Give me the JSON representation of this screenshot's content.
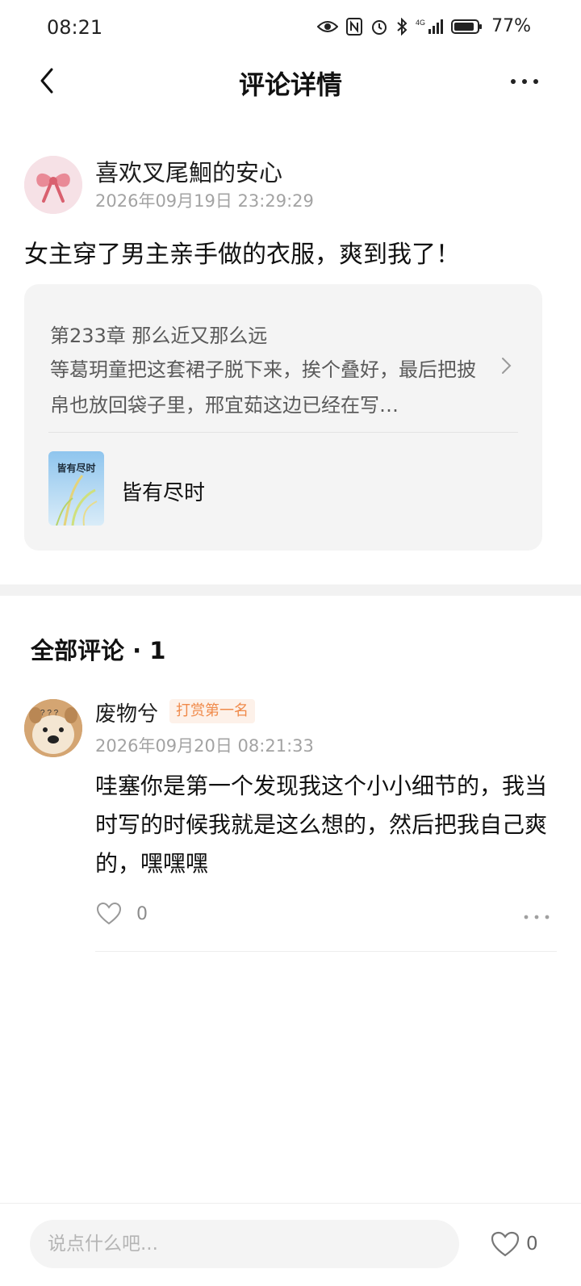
{
  "status_bar": {
    "time": "08:21",
    "battery": "77%",
    "signal_label": "4G"
  },
  "nav": {
    "title": "评论详情"
  },
  "post": {
    "author_name": "喜欢叉尾鮰的安心",
    "timestamp": "2026年09月19日 23:29:29",
    "text": "女主穿了男主亲手做的衣服，爽到我了！",
    "chapter_title": "第233章 那么近又那么远",
    "chapter_excerpt": "等葛玥童把这套裙子脱下来，挨个叠好，最后把披帛也放回袋子里，邢宜茹这边已经在写…",
    "book_title": "皆有尽时",
    "book_cover_text": "皆有尽时"
  },
  "comments_section": {
    "header": "全部评论 · 1",
    "comments": [
      {
        "author": "废物兮",
        "badge": "打赏第一名",
        "timestamp": "2026年09月20日 08:21:33",
        "text": "哇塞你是第一个发现我这个小小细节的，我当时写的时候我就是这么想的，然后把我自己爽的，嘿嘿嘿",
        "likes": "0"
      }
    ]
  },
  "bottom_bar": {
    "input_placeholder": "说点什么吧...",
    "likes": "0"
  },
  "colors": {
    "badge_text": "#f08a4a",
    "badge_bg": "#fdf1e9",
    "card_bg": "#f4f4f4",
    "muted_text": "#a3a3a3"
  }
}
